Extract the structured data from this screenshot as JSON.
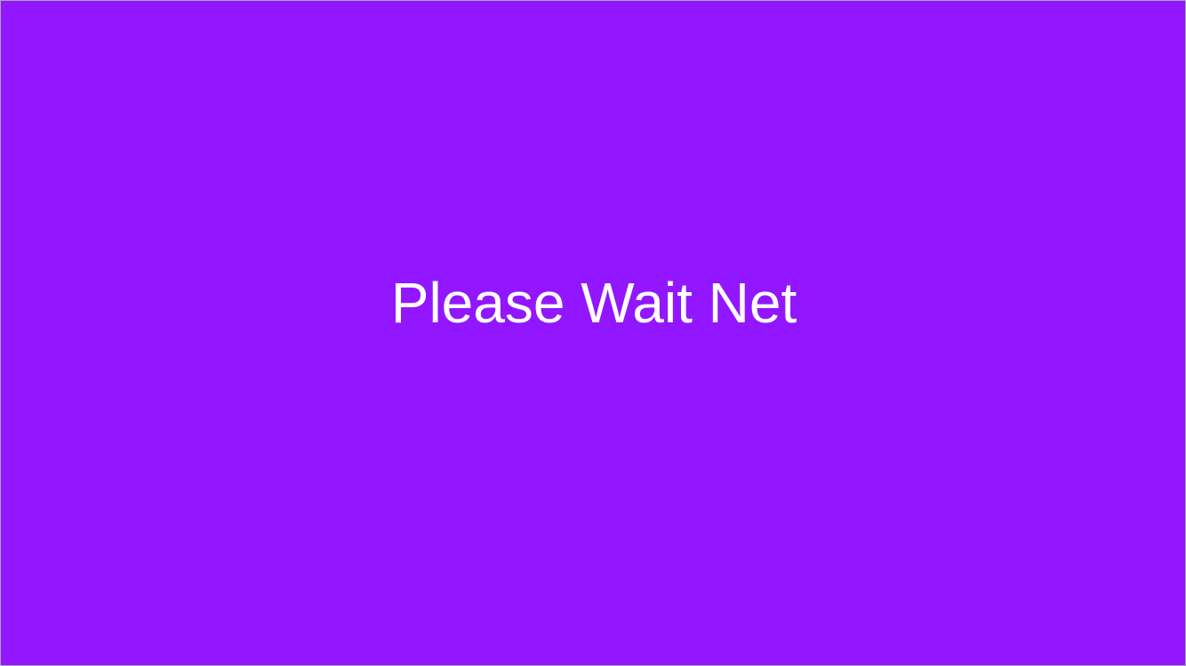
{
  "screen": {
    "message": "Please Wait Net"
  },
  "colors": {
    "background": "#9216ff",
    "text": "#ffffff",
    "frame_border": "#a9a9b3"
  }
}
